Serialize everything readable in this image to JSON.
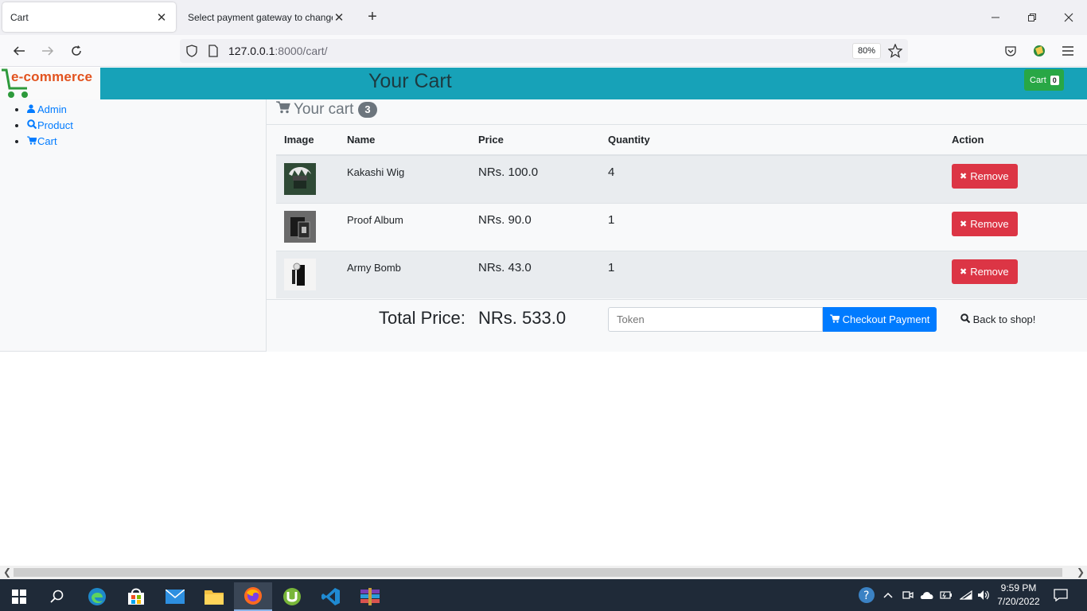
{
  "browser": {
    "tabs": [
      {
        "title": "Cart",
        "active": true
      },
      {
        "title": "Select payment gateway to change p",
        "active": false
      }
    ],
    "url_host": "127.0.0.1",
    "url_rest": ":8000/cart/",
    "zoom": "80%"
  },
  "header": {
    "logo_text": "e-commerce",
    "title": "Your Cart",
    "cart_label": "Cart",
    "cart_count": "0"
  },
  "sidebar": {
    "items": [
      {
        "label": "Admin",
        "icon": "user-icon"
      },
      {
        "label": "Product",
        "icon": "search-icon"
      },
      {
        "label": "Cart",
        "icon": "cart-icon"
      }
    ]
  },
  "cart": {
    "heading": "Your cart",
    "count": "3",
    "columns": [
      "Image",
      "Name",
      "Price",
      "Quantity",
      "Action"
    ],
    "rows": [
      {
        "name": "Kakashi Wig",
        "price": "NRs. 100.0",
        "quantity": "4",
        "action": "Remove"
      },
      {
        "name": "Proof Album",
        "price": "NRs. 90.0",
        "quantity": "1",
        "action": "Remove"
      },
      {
        "name": "Army Bomb",
        "price": "NRs. 43.0",
        "quantity": "1",
        "action": "Remove"
      }
    ],
    "total_label": "Total Price:",
    "total_value": "NRs. 533.0",
    "token_placeholder": "Token",
    "checkout_label": "Checkout Payment",
    "back_label": "Back to shop!"
  },
  "taskbar": {
    "time": "9:59 PM",
    "date": "7/20/2022"
  },
  "colors": {
    "header": "#17a2b8",
    "cart_button": "#28a745",
    "remove_button": "#dc3545",
    "checkout_button": "#007bff"
  }
}
